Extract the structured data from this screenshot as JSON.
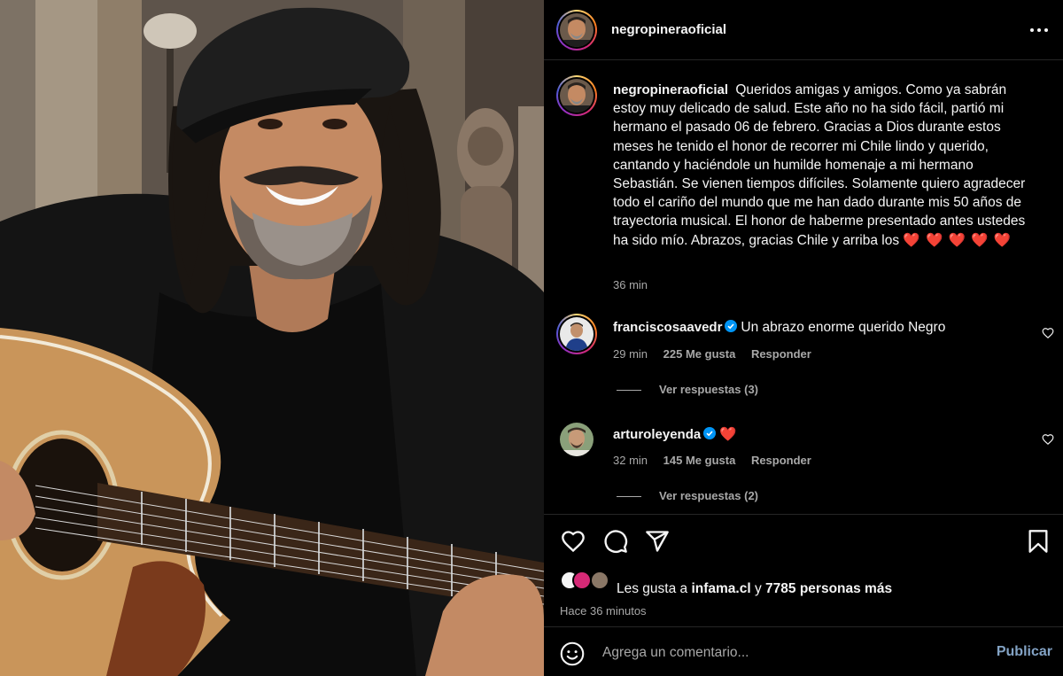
{
  "post": {
    "author": "negropineraoficial",
    "more_icon": "more-horizontal-icon"
  },
  "caption": {
    "username": "negropineraoficial",
    "text": "Queridos amigas y amigos. Como ya sabrán estoy muy delicado de salud. Este año no ha sido fácil, partió mi hermano el pasado 06 de febrero. Gracias a Dios durante estos meses he tenido el honor de recorrer mi Chile lindo y querido, cantando y haciéndole un humilde homenaje a mi hermano Sebastián. Se vienen tiempos difíciles. Solamente quiero agradecer todo el cariño del mundo que me han dado durante mis 50 años de trayectoria musical. El honor de haberme presentado antes ustedes ha sido mío. Abrazos, gracias Chile y arriba los",
    "hearts": "❤️ ❤️ ❤️ ❤️ ❤️",
    "time": "36 min"
  },
  "comments": [
    {
      "username": "franciscosaavedr",
      "verified": true,
      "text": "Un abrazo enorme querido Negro",
      "time": "29 min",
      "likes": "225 Me gusta",
      "reply": "Responder",
      "view_replies": "Ver respuestas (3)"
    },
    {
      "username": "arturoleyenda",
      "verified": true,
      "text": "❤️",
      "time": "32 min",
      "likes": "145 Me gusta",
      "reply": "Responder",
      "view_replies": "Ver respuestas (2)"
    }
  ],
  "actions": {
    "likes_prefix": "Les gusta a",
    "liker": "infama.cl",
    "likes_and": "y",
    "others": "7785 personas más",
    "time_ago": "Hace 36 minutos"
  },
  "comment_box": {
    "placeholder": "Agrega un comentario...",
    "publish_label": "Publicar"
  },
  "colors": {
    "background": "#000000",
    "text": "#f5f5f5",
    "muted": "#a8a8a8",
    "verified": "#0095f6",
    "heart": "#ff3040",
    "publish": "#83a3c5"
  }
}
